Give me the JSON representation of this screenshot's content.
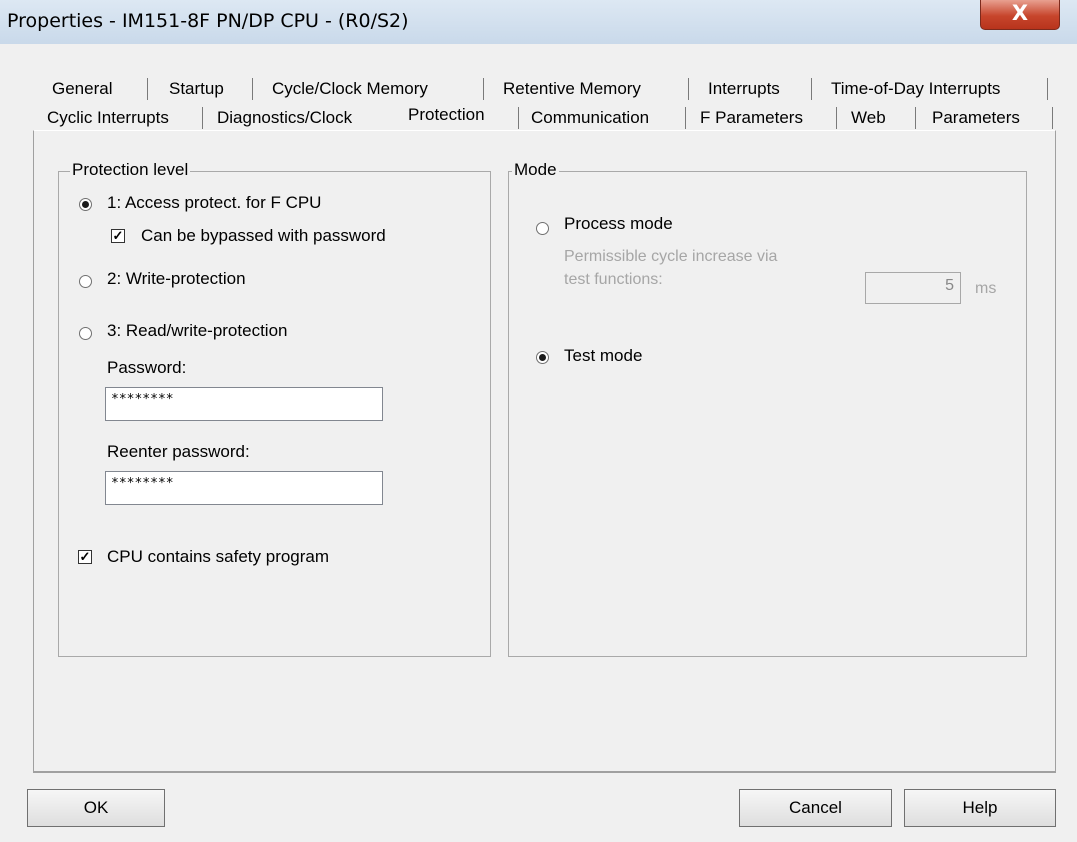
{
  "window": {
    "title": "Properties - IM151-8F PN/DP CPU - (R0/S2)",
    "close_glyph": "X"
  },
  "tabs": {
    "row1": [
      "General",
      "Startup",
      "Cycle/Clock Memory",
      "Retentive Memory",
      "Interrupts",
      "Time-of-Day Interrupts"
    ],
    "row2": [
      "Cyclic Interrupts",
      "Diagnostics/Clock",
      "Protection",
      "Communication",
      "F Parameters",
      "Web",
      "Parameters"
    ],
    "active": "Protection"
  },
  "protection": {
    "legend": "Protection level",
    "option1": "1: Access protect. for F CPU",
    "bypass": "Can be bypassed with password",
    "option2": "2: Write-protection",
    "option3": "3: Read/write-protection",
    "password_label": "Password:",
    "password_value": "********",
    "reenter_label": "Reenter password:",
    "reenter_value": "********",
    "safety": "CPU contains safety program",
    "selected": "option1",
    "bypass_checked": true,
    "safety_checked": true
  },
  "mode": {
    "legend": "Mode",
    "process": "Process mode",
    "cycle_line1": "Permissible  cycle increase via",
    "cycle_line2": "test functions:",
    "cycle_value": "5",
    "cycle_unit": "ms",
    "test": "Test mode",
    "selected": "test"
  },
  "buttons": {
    "ok": "OK",
    "cancel": "Cancel",
    "help": "Help"
  }
}
